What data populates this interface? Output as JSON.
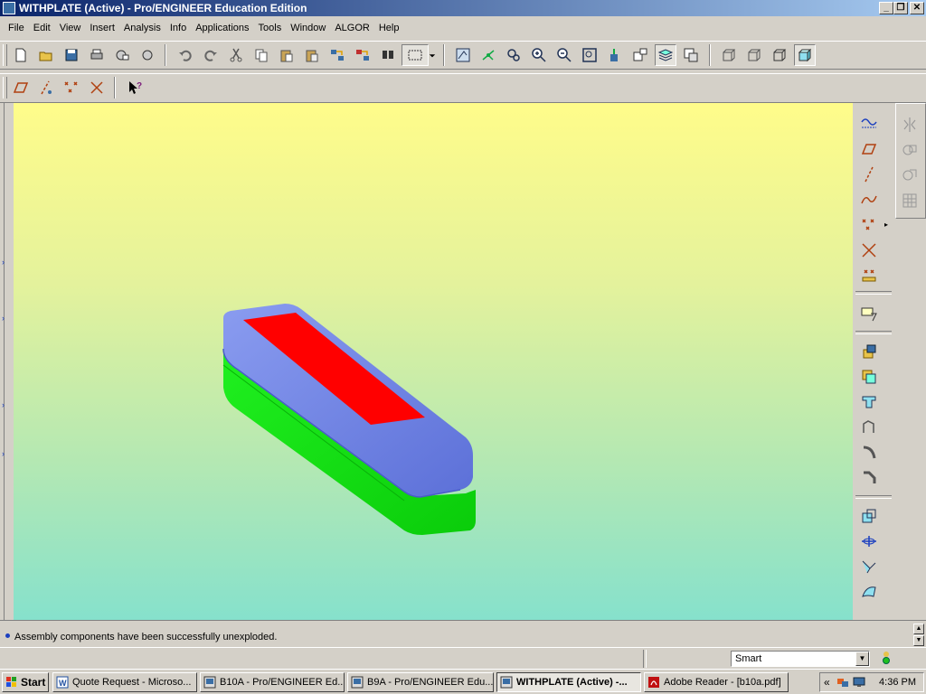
{
  "window": {
    "title": "WITHPLATE (Active) - Pro/ENGINEER Education Edition",
    "controls": {
      "minimize": "_",
      "maximize": "❐",
      "close": "✕"
    }
  },
  "menu": {
    "items": [
      "File",
      "Edit",
      "View",
      "Insert",
      "Analysis",
      "Info",
      "Applications",
      "Tools",
      "Window",
      "ALGOR",
      "Help"
    ]
  },
  "toolbar_top": {
    "icons": [
      "new-icon",
      "open-icon",
      "save-icon",
      "print-icon",
      "email-icon",
      "email-link-icon",
      "undo-icon",
      "redo-icon",
      "cut-icon",
      "copy-icon",
      "paste-icon",
      "paste-special-icon",
      "regenerate-icon",
      "regen-manager-icon",
      "find-icon",
      "select-box-icon",
      "repaint-icon",
      "spin-center-icon",
      "orient-icon",
      "zoom-in-icon",
      "zoom-out-icon",
      "refit-icon",
      "reorient-icon",
      "saved-views-icon",
      "layers-icon",
      "view-manager-icon",
      "wireframe-icon",
      "hidden-line-icon",
      "no-hidden-icon",
      "shading-icon"
    ]
  },
  "toolbar_second": {
    "icons": [
      "datum-plane-display-icon",
      "datum-axis-display-icon",
      "point-display-icon",
      "csys-display-icon",
      "context-help-icon"
    ]
  },
  "right_toolbar": {
    "icons": [
      "sketch-curve-icon",
      "datum-plane-icon",
      "datum-axis-icon",
      "datum-curve-icon",
      "datum-point-icon",
      "datum-csys-icon",
      "analysis-feature-icon",
      "annotation-icon",
      "extrude-icon",
      "revolve-icon",
      "sweep-icon",
      "blend-icon",
      "round-icon",
      "chamfer-icon",
      "shell-icon",
      "rib-icon",
      "draft-icon",
      "surface-icon"
    ],
    "secondary_icons": [
      "mirror-icon",
      "merge-icon",
      "trim-icon",
      "pattern-icon"
    ]
  },
  "model": {
    "colors": {
      "top_part": "#7b8fe6",
      "bottom_part": "#10e010",
      "plate": "#ff0000"
    }
  },
  "message": {
    "text": "Assembly components have been successfully unexploded."
  },
  "status": {
    "filter_value": "Smart"
  },
  "taskbar": {
    "start_label": "Start",
    "tasks": [
      {
        "label": "Quote Request - Microso...",
        "active": false
      },
      {
        "label": "B10A - Pro/ENGINEER Ed...",
        "active": false
      },
      {
        "label": "B9A - Pro/ENGINEER Edu...",
        "active": false
      },
      {
        "label": "WITHPLATE (Active) -...",
        "active": true
      },
      {
        "label": "Adobe Reader - [b10a.pdf]",
        "active": false
      }
    ],
    "tray_expand": "«",
    "clock": "4:36 PM"
  }
}
